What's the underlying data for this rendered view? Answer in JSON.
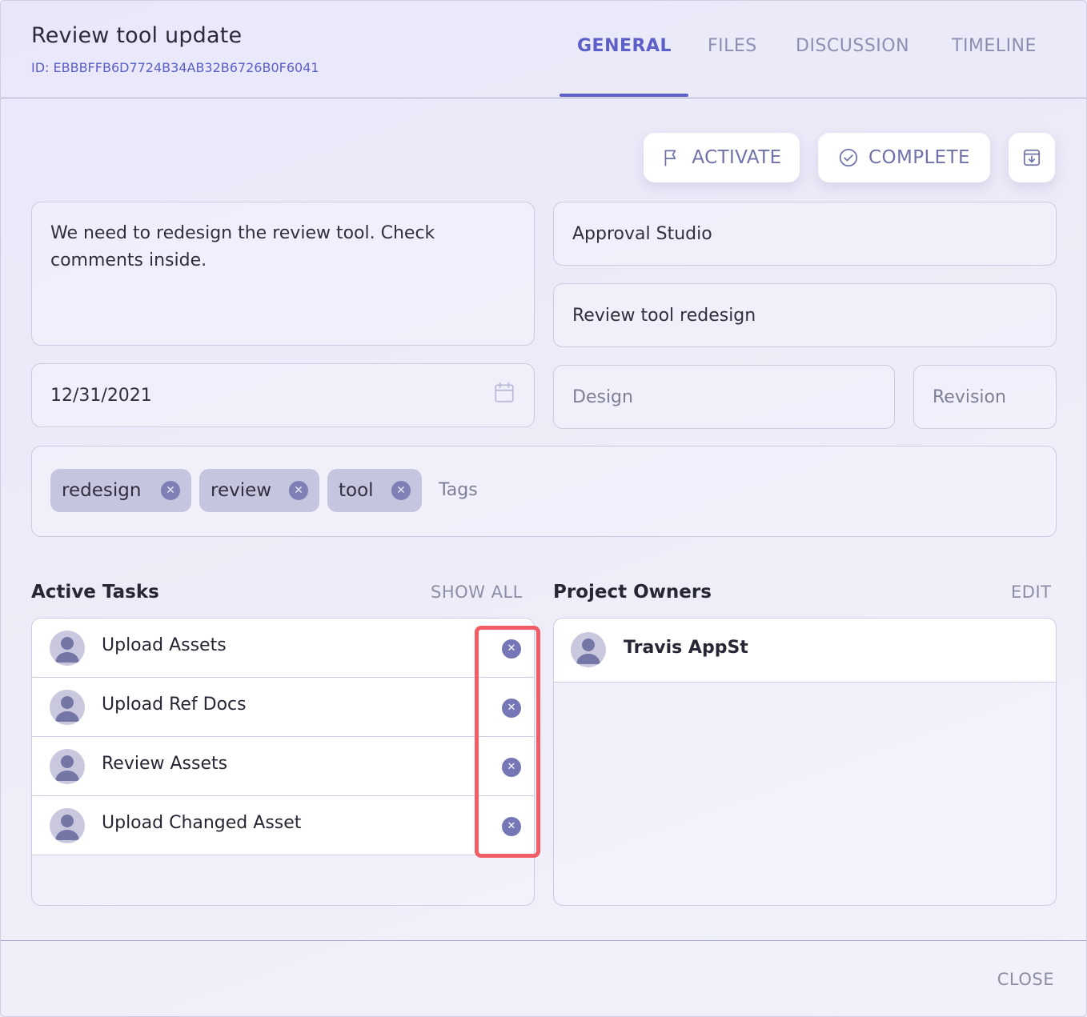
{
  "header": {
    "title": "Review tool update",
    "id_label": "ID: EBBBFFB6D7724B34AB32B6726B0F6041"
  },
  "tabs": [
    {
      "label": "GENERAL",
      "active": true
    },
    {
      "label": "FILES",
      "active": false
    },
    {
      "label": "DISCUSSION",
      "active": false
    },
    {
      "label": "TIMELINE",
      "active": false
    }
  ],
  "actions": {
    "activate_label": "ACTIVATE",
    "complete_label": "COMPLETE",
    "export_icon": "download-box-icon"
  },
  "form": {
    "description": "We need to redesign the review tool. Check comments inside.",
    "company": "Approval Studio",
    "project": "Review tool redesign",
    "due_date": "12/31/2021",
    "category_placeholder": "Design",
    "revision_placeholder": "Revision",
    "tags": [
      "redesign",
      "review",
      "tool"
    ],
    "tags_placeholder": "Tags"
  },
  "active_tasks": {
    "title": "Active Tasks",
    "show_all_label": "SHOW ALL",
    "items": [
      "Upload Assets",
      "Upload Ref Docs",
      "Review Assets",
      "Upload Changed Asset"
    ]
  },
  "project_owners": {
    "title": "Project Owners",
    "edit_label": "EDIT",
    "items": [
      "Travis AppSt"
    ]
  },
  "footer": {
    "close_label": "CLOSE"
  },
  "colors": {
    "accent": "#5b5fc7",
    "highlight": "#f05d67",
    "tag_bg": "#c6c5e0"
  }
}
